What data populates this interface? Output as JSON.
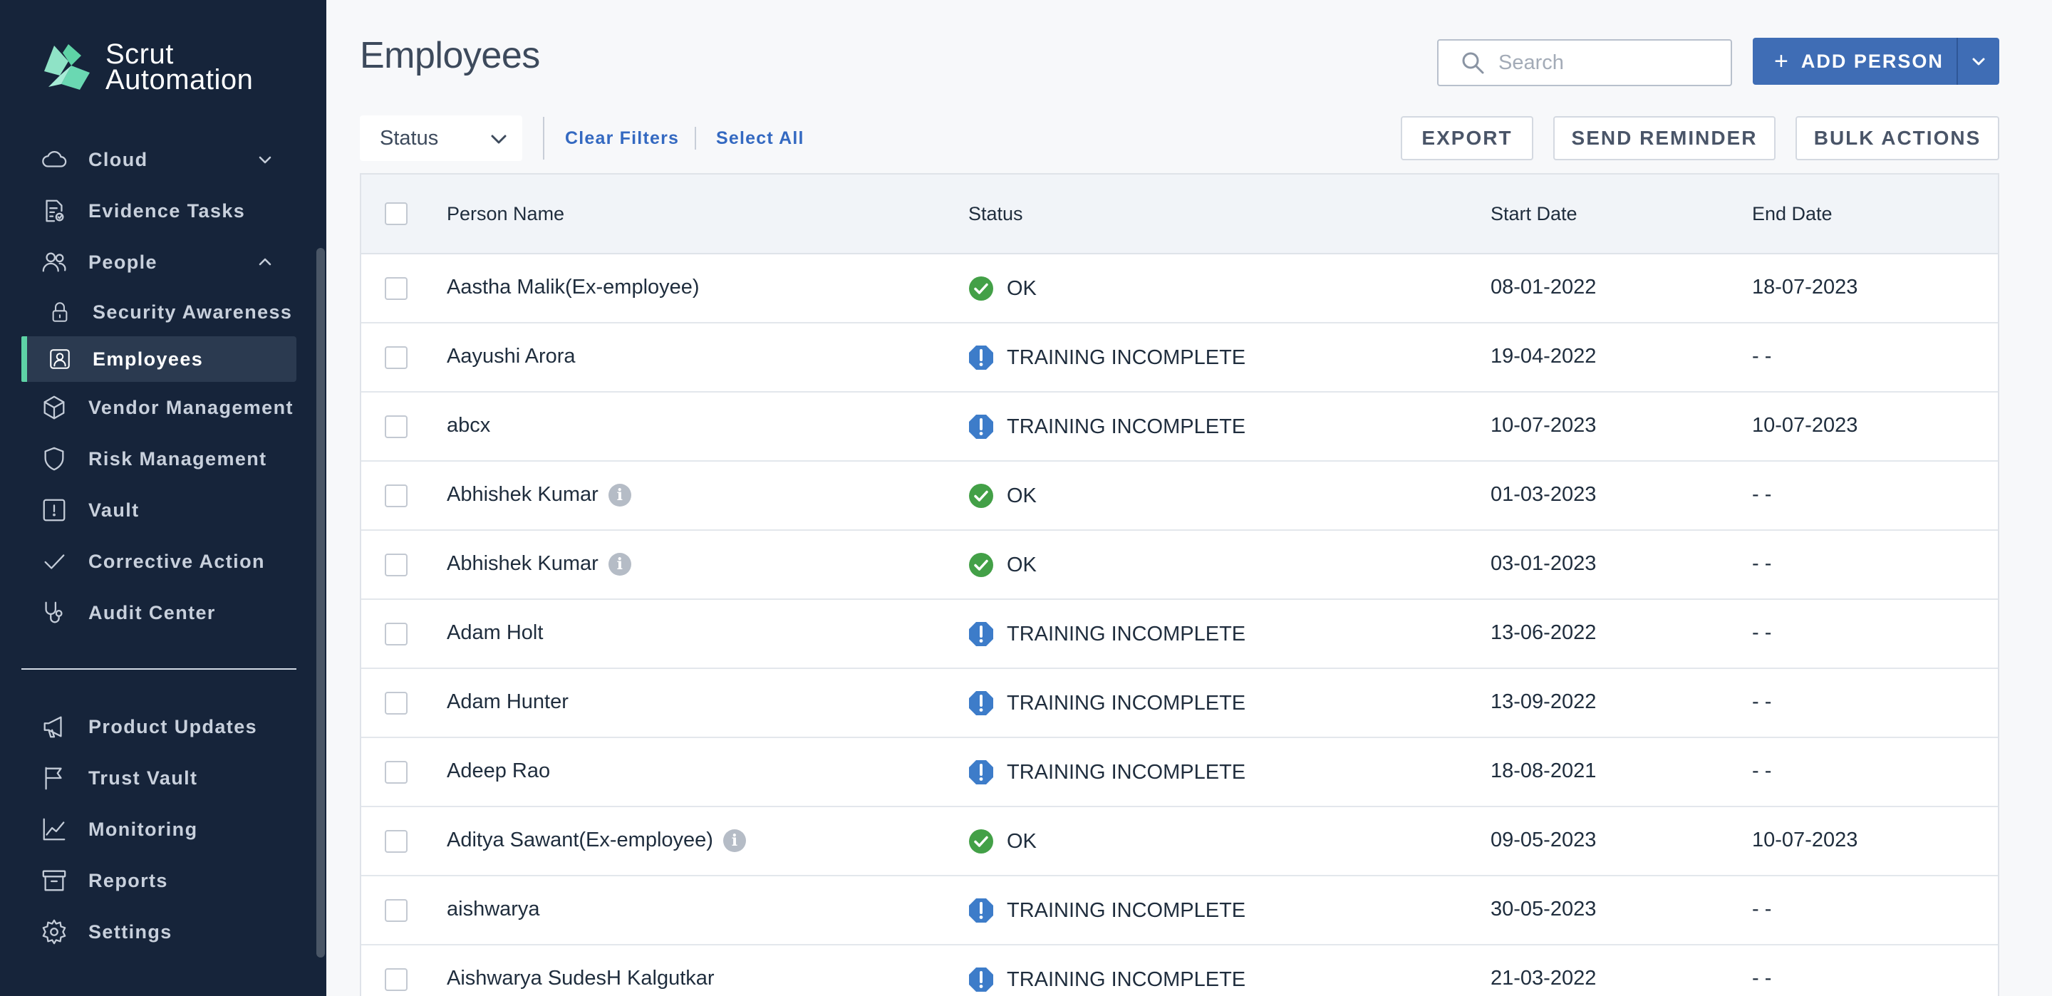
{
  "brand": {
    "line1": "Scrut",
    "line2": "Automation"
  },
  "sidebar": {
    "items": [
      {
        "label": "Cloud",
        "icon": "cloud-icon",
        "chevron": "down"
      },
      {
        "label": "Evidence Tasks",
        "icon": "evidence-tasks-icon"
      },
      {
        "label": "People",
        "icon": "people-icon",
        "chevron": "up"
      },
      {
        "label": "Security Awareness",
        "icon": "lock-icon",
        "sub": true
      },
      {
        "label": "Employees",
        "icon": "employee-badge-icon",
        "sub": true,
        "active": true
      },
      {
        "label": "Vendor Management",
        "icon": "cube-icon"
      },
      {
        "label": "Risk Management",
        "icon": "shield-icon"
      },
      {
        "label": "Vault",
        "icon": "vault-icon"
      },
      {
        "label": "Corrective Action",
        "icon": "check-icon"
      },
      {
        "label": "Audit Center",
        "icon": "stethoscope-icon"
      }
    ],
    "bottom_items": [
      {
        "label": "Product Updates",
        "icon": "megaphone-icon"
      },
      {
        "label": "Trust Vault",
        "icon": "flag-icon"
      },
      {
        "label": "Monitoring",
        "icon": "chart-line-icon"
      },
      {
        "label": "Reports",
        "icon": "archive-icon"
      },
      {
        "label": "Settings",
        "icon": "gear-icon"
      }
    ]
  },
  "header": {
    "title": "Employees",
    "search_placeholder": "Search",
    "add_label": "ADD PERSON"
  },
  "filters": {
    "status_label": "Status",
    "clear_label": "Clear Filters",
    "select_all_label": "Select All",
    "export_label": "EXPORT",
    "reminder_label": "SEND REMINDER",
    "bulk_label": "BULK ACTIONS"
  },
  "table": {
    "columns": [
      "Person Name",
      "Status",
      "Start Date",
      "End Date"
    ],
    "rows": [
      {
        "name": "Aastha Malik(Ex-employee)",
        "info": false,
        "status": "OK",
        "status_type": "ok",
        "start": "08-01-2022",
        "end": "18-07-2023"
      },
      {
        "name": "Aayushi Arora",
        "info": false,
        "status": "TRAINING INCOMPLETE",
        "status_type": "warn",
        "start": "19-04-2022",
        "end": "- -"
      },
      {
        "name": "abcx",
        "info": false,
        "status": "TRAINING INCOMPLETE",
        "status_type": "warn",
        "start": "10-07-2023",
        "end": "10-07-2023"
      },
      {
        "name": "Abhishek Kumar",
        "info": true,
        "status": "OK",
        "status_type": "ok",
        "start": "01-03-2023",
        "end": "- -"
      },
      {
        "name": "Abhishek Kumar",
        "info": true,
        "status": "OK",
        "status_type": "ok",
        "start": "03-01-2023",
        "end": "- -"
      },
      {
        "name": "Adam Holt",
        "info": false,
        "status": "TRAINING INCOMPLETE",
        "status_type": "warn",
        "start": "13-06-2022",
        "end": "- -"
      },
      {
        "name": "Adam Hunter",
        "info": false,
        "status": "TRAINING INCOMPLETE",
        "status_type": "warn",
        "start": "13-09-2022",
        "end": "- -"
      },
      {
        "name": "Adeep Rao",
        "info": false,
        "status": "TRAINING INCOMPLETE",
        "status_type": "warn",
        "start": "18-08-2021",
        "end": "- -"
      },
      {
        "name": "Aditya Sawant(Ex-employee)",
        "info": true,
        "status": "OK",
        "status_type": "ok",
        "start": "09-05-2023",
        "end": "10-07-2023"
      },
      {
        "name": "aishwarya",
        "info": false,
        "status": "TRAINING INCOMPLETE",
        "status_type": "warn",
        "start": "30-05-2023",
        "end": "- -"
      },
      {
        "name": "Aishwarya SudesH Kalgutkar",
        "info": false,
        "status": "TRAINING INCOMPLETE",
        "status_type": "warn",
        "start": "21-03-2022",
        "end": "- -"
      }
    ]
  },
  "colors": {
    "sidebar_bg": "#16243a",
    "accent": "#3f6db5",
    "active_marker": "#5ed3a6",
    "ok": "#43a047",
    "warn": "#3d7cc9"
  }
}
